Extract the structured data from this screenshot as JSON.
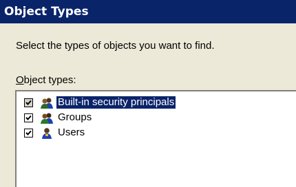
{
  "dialog": {
    "title": "Object Types",
    "instruction": "Select the types of objects you want to find.",
    "list_label_mnemonic": "O",
    "list_label_rest": "bject types:"
  },
  "object_types": [
    {
      "label": "Built-in security principals",
      "checked": true,
      "selected": true,
      "icon": "security-principals-icon"
    },
    {
      "label": "Groups",
      "checked": true,
      "selected": false,
      "icon": "group-icon"
    },
    {
      "label": "Users",
      "checked": true,
      "selected": false,
      "icon": "user-icon"
    }
  ],
  "colors": {
    "title_bar": "#0a246a",
    "selection": "#0a246a",
    "dialog_bg": "#ece9d8"
  }
}
